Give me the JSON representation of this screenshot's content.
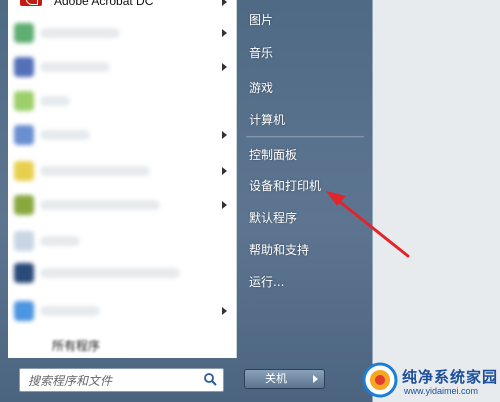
{
  "start_menu": {
    "programs": [
      {
        "label": "Adobe Acrobat DC",
        "has_submenu": true
      },
      {
        "label": "",
        "has_submenu": true
      },
      {
        "label": "",
        "has_submenu": true
      },
      {
        "label": "",
        "has_submenu": false
      },
      {
        "label": "",
        "has_submenu": true
      },
      {
        "label": "",
        "has_submenu": true
      },
      {
        "label": "",
        "has_submenu": true
      },
      {
        "label": "",
        "has_submenu": false
      },
      {
        "label": "",
        "has_submenu": false
      },
      {
        "label": "",
        "has_submenu": true
      }
    ],
    "all_programs_partial": "所有程序",
    "search_placeholder": "搜索程序和文件",
    "right_items": {
      "pictures": "图片",
      "music": "音乐",
      "games": "游戏",
      "computer": "计算机",
      "control_panel": "控制面板",
      "devices_printers": "设备和打印机",
      "default_programs": "默认程序",
      "help_support": "帮助和支持",
      "run": "运行..."
    },
    "shutdown_label": "关机"
  },
  "watermark": {
    "title": "纯净系统家园",
    "url": "www.yidaimei.com"
  },
  "colors": {
    "menu_blue": "#5a7390",
    "annotation_red": "#e0262c",
    "watermark_blue": "#1b4f9c"
  }
}
